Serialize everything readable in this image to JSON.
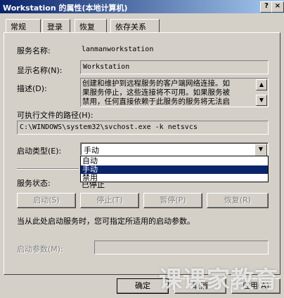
{
  "window": {
    "title": "Workstation 的属性(本地计算机)",
    "help_btn": "?",
    "close_btn": "×"
  },
  "tabs": [
    {
      "label": "常规"
    },
    {
      "label": "登录"
    },
    {
      "label": "恢复"
    },
    {
      "label": "依存关系"
    }
  ],
  "general": {
    "service_name_label": "服务名称:",
    "service_name_value": "lanmanworkstation",
    "display_name_label": "显示名称(N):",
    "display_name_value": "Workstation",
    "description_label": "描述(D):",
    "description_lines": [
      "创建和维护到远程服务的客户端网络连接。如",
      "果服务停止，这些连接将不可用。如果服务被",
      "禁用，任何直接依赖于此服务的服务将无法启"
    ],
    "path_label": "可执行文件的路径(H):",
    "path_value": "C:\\WINDOWS\\system32\\svchost.exe -k netsvcs",
    "startup_type_label": "启动类型(E):",
    "startup_type_value": "手动",
    "startup_options": [
      {
        "label": "自动",
        "selected": false
      },
      {
        "label": "手动",
        "selected": true
      },
      {
        "label": "禁用",
        "selected": false
      }
    ],
    "service_status_label": "服务状态:",
    "service_status_value": "已停止",
    "buttons": {
      "start": "启动(S)",
      "stop": "停止(T)",
      "pause": "暂停(P)",
      "resume": "恢复(R)"
    },
    "hint": "当从此处启动服务时，您可指定所适用的启动参数。",
    "start_params_label": "启动参数(M):"
  },
  "footer": {
    "ok": "确定",
    "cancel": "取消",
    "apply": "应用(A)"
  },
  "watermark": "课课家教育",
  "icons": {
    "scroll_up": "▲",
    "scroll_down": "▼",
    "dropdown": "▼"
  }
}
